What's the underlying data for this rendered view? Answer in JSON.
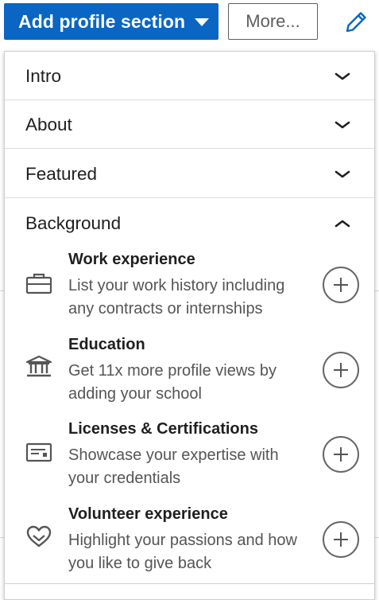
{
  "toolbar": {
    "add_section_label": "Add profile section",
    "more_label": "More...",
    "edit_icon": "pencil-icon",
    "accent_color": "#0a66c2"
  },
  "sections": [
    {
      "label": "Intro",
      "state": "collapsed"
    },
    {
      "label": "About",
      "state": "collapsed"
    },
    {
      "label": "Featured",
      "state": "collapsed"
    },
    {
      "label": "Background",
      "state": "expanded"
    }
  ],
  "background_items": [
    {
      "title": "Work experience",
      "description": "List your work history including any contracts or internships",
      "icon": "briefcase-icon"
    },
    {
      "title": "Education",
      "description": "Get 11x more profile views by adding your school",
      "icon": "school-building-icon"
    },
    {
      "title": "Licenses & Certifications",
      "description": "Showcase your expertise with your credentials",
      "icon": "certificate-icon"
    },
    {
      "title": "Volunteer experience",
      "description": "Highlight your passions and how you like to give back",
      "icon": "heart-hands-icon"
    }
  ]
}
